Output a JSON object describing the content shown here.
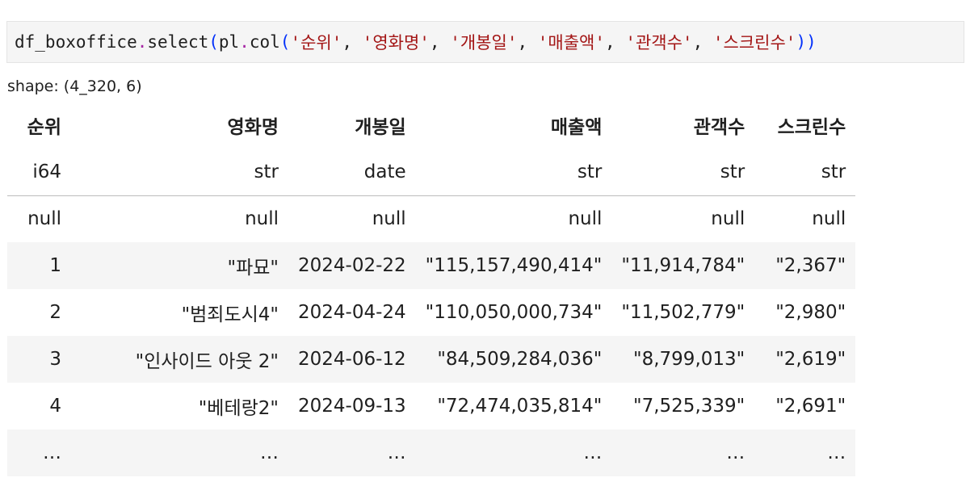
{
  "code": {
    "prefix": "df_boxoffice",
    "dot1": ".",
    "method": "select",
    "paren_open": "(",
    "pl": "pl",
    "dot2": ".",
    "func": "col",
    "paren_open2": "(",
    "args": [
      "'순위'",
      "'영화명'",
      "'개봉일'",
      "'매출액'",
      "'관객수'",
      "'스크린수'"
    ],
    "sep": ", ",
    "paren_close": "))"
  },
  "shape_text": "shape: (4_320, 6)",
  "table": {
    "columns": [
      "순위",
      "영화명",
      "개봉일",
      "매출액",
      "관객수",
      "스크린수"
    ],
    "dtypes": [
      "i64",
      "str",
      "date",
      "str",
      "str",
      "str"
    ],
    "rows": [
      [
        "null",
        "null",
        "null",
        "null",
        "null",
        "null"
      ],
      [
        "1",
        "\"파묘\"",
        "2024-02-22",
        "\"115,157,490,414\"",
        "\"11,914,784\"",
        "\"2,367\""
      ],
      [
        "2",
        "\"범죄도시4\"",
        "2024-04-24",
        "\"110,050,000,734\"",
        "\"11,502,779\"",
        "\"2,980\""
      ],
      [
        "3",
        "\"인사이드 아웃 2\"",
        "2024-06-12",
        "\"84,509,284,036\"",
        "\"8,799,013\"",
        "\"2,619\""
      ],
      [
        "4",
        "\"베테랑2\"",
        "2024-09-13",
        "\"72,474,035,814\"",
        "\"7,525,339\"",
        "\"2,691\""
      ],
      [
        "…",
        "…",
        "…",
        "…",
        "…",
        "…"
      ]
    ]
  }
}
